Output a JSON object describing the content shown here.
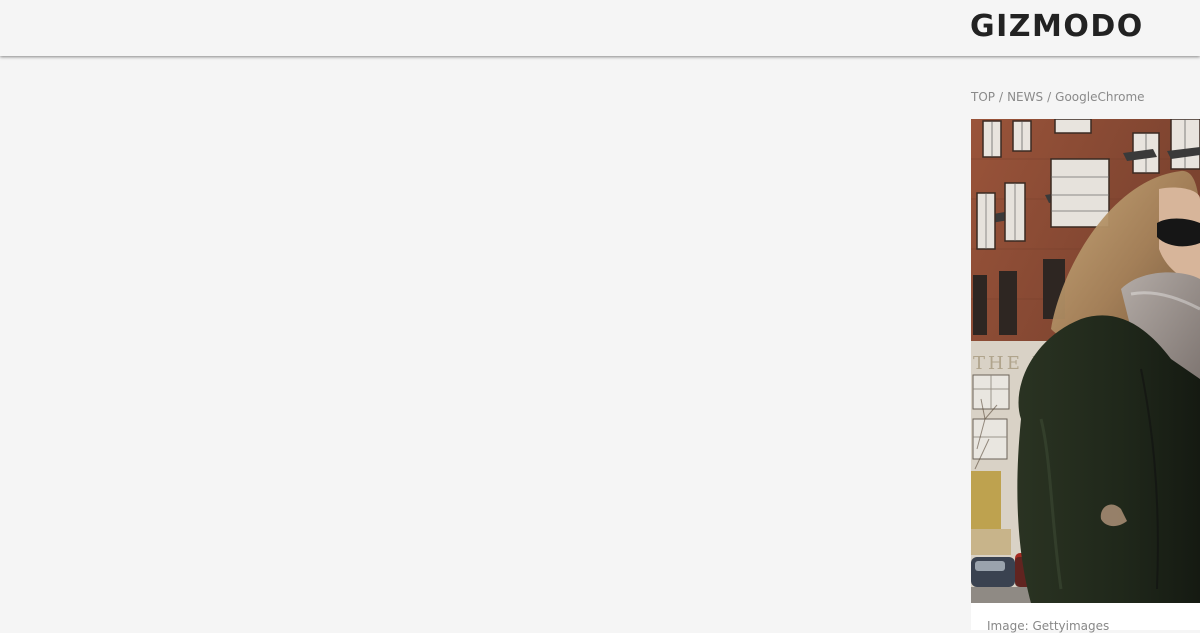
{
  "header": {
    "logo_text": "GIZMODO"
  },
  "breadcrumb": {
    "items": [
      "TOP",
      "NEWS",
      "GoogleChrome"
    ],
    "separator": "/"
  },
  "hero": {
    "sign_text": "THE PO",
    "caption": "Image: Gettyimages"
  },
  "colors": {
    "background": "#f5f5f5",
    "logo": "#222222",
    "breadcrumb": "#8a8a8a",
    "brick": "#8b4a32"
  }
}
